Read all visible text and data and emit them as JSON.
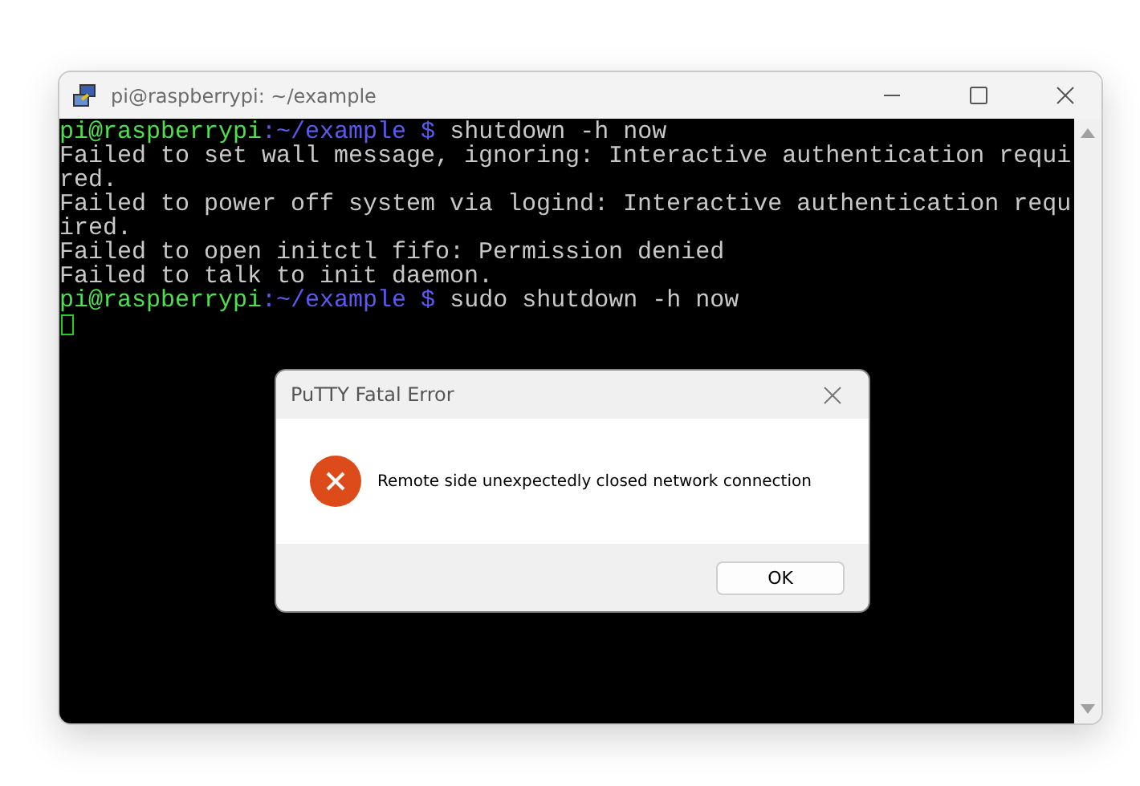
{
  "window": {
    "title": "pi@raspberrypi: ~/example"
  },
  "terminal": {
    "lines": [
      {
        "kind": "prompt",
        "user": "pi@raspberrypi",
        "path": ":~/example $",
        "command": " shutdown -h now"
      },
      {
        "kind": "output",
        "text": "Failed to set wall message, ignoring: Interactive authentication requi"
      },
      {
        "kind": "output",
        "text": "red."
      },
      {
        "kind": "output",
        "text": "Failed to power off system via logind: Interactive authentication requ"
      },
      {
        "kind": "output",
        "text": "ired."
      },
      {
        "kind": "output",
        "text": "Failed to open initctl fifo: Permission denied"
      },
      {
        "kind": "output",
        "text": "Failed to talk to init daemon."
      },
      {
        "kind": "prompt",
        "user": "pi@raspberrypi",
        "path": ":~/example $",
        "command": " sudo shutdown -h now"
      }
    ]
  },
  "dialog": {
    "title": "PuTTY Fatal Error",
    "message": "Remote side unexpectedly closed network connection",
    "button": "OK"
  }
}
